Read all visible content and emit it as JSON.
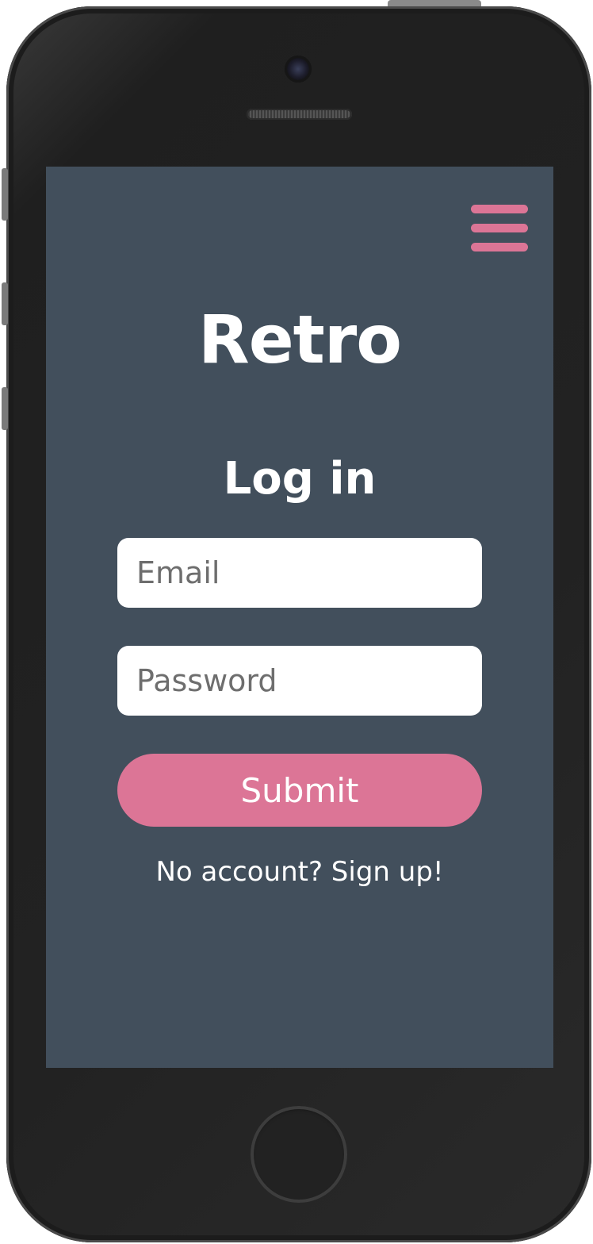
{
  "app": {
    "title": "Retro"
  },
  "header": {
    "menu_icon": "hamburger-menu-icon"
  },
  "login_form": {
    "heading": "Log in",
    "email_placeholder": "Email",
    "email_value": "",
    "password_placeholder": "Password",
    "password_value": "",
    "submit_label": "Submit",
    "signup_text": "No account? Sign up!"
  },
  "colors": {
    "screen_background": "#424f5c",
    "accent": "#dc7596",
    "text": "#ffffff",
    "input_background": "#ffffff",
    "placeholder": "#6e6e6e",
    "device_body": "#222222"
  }
}
